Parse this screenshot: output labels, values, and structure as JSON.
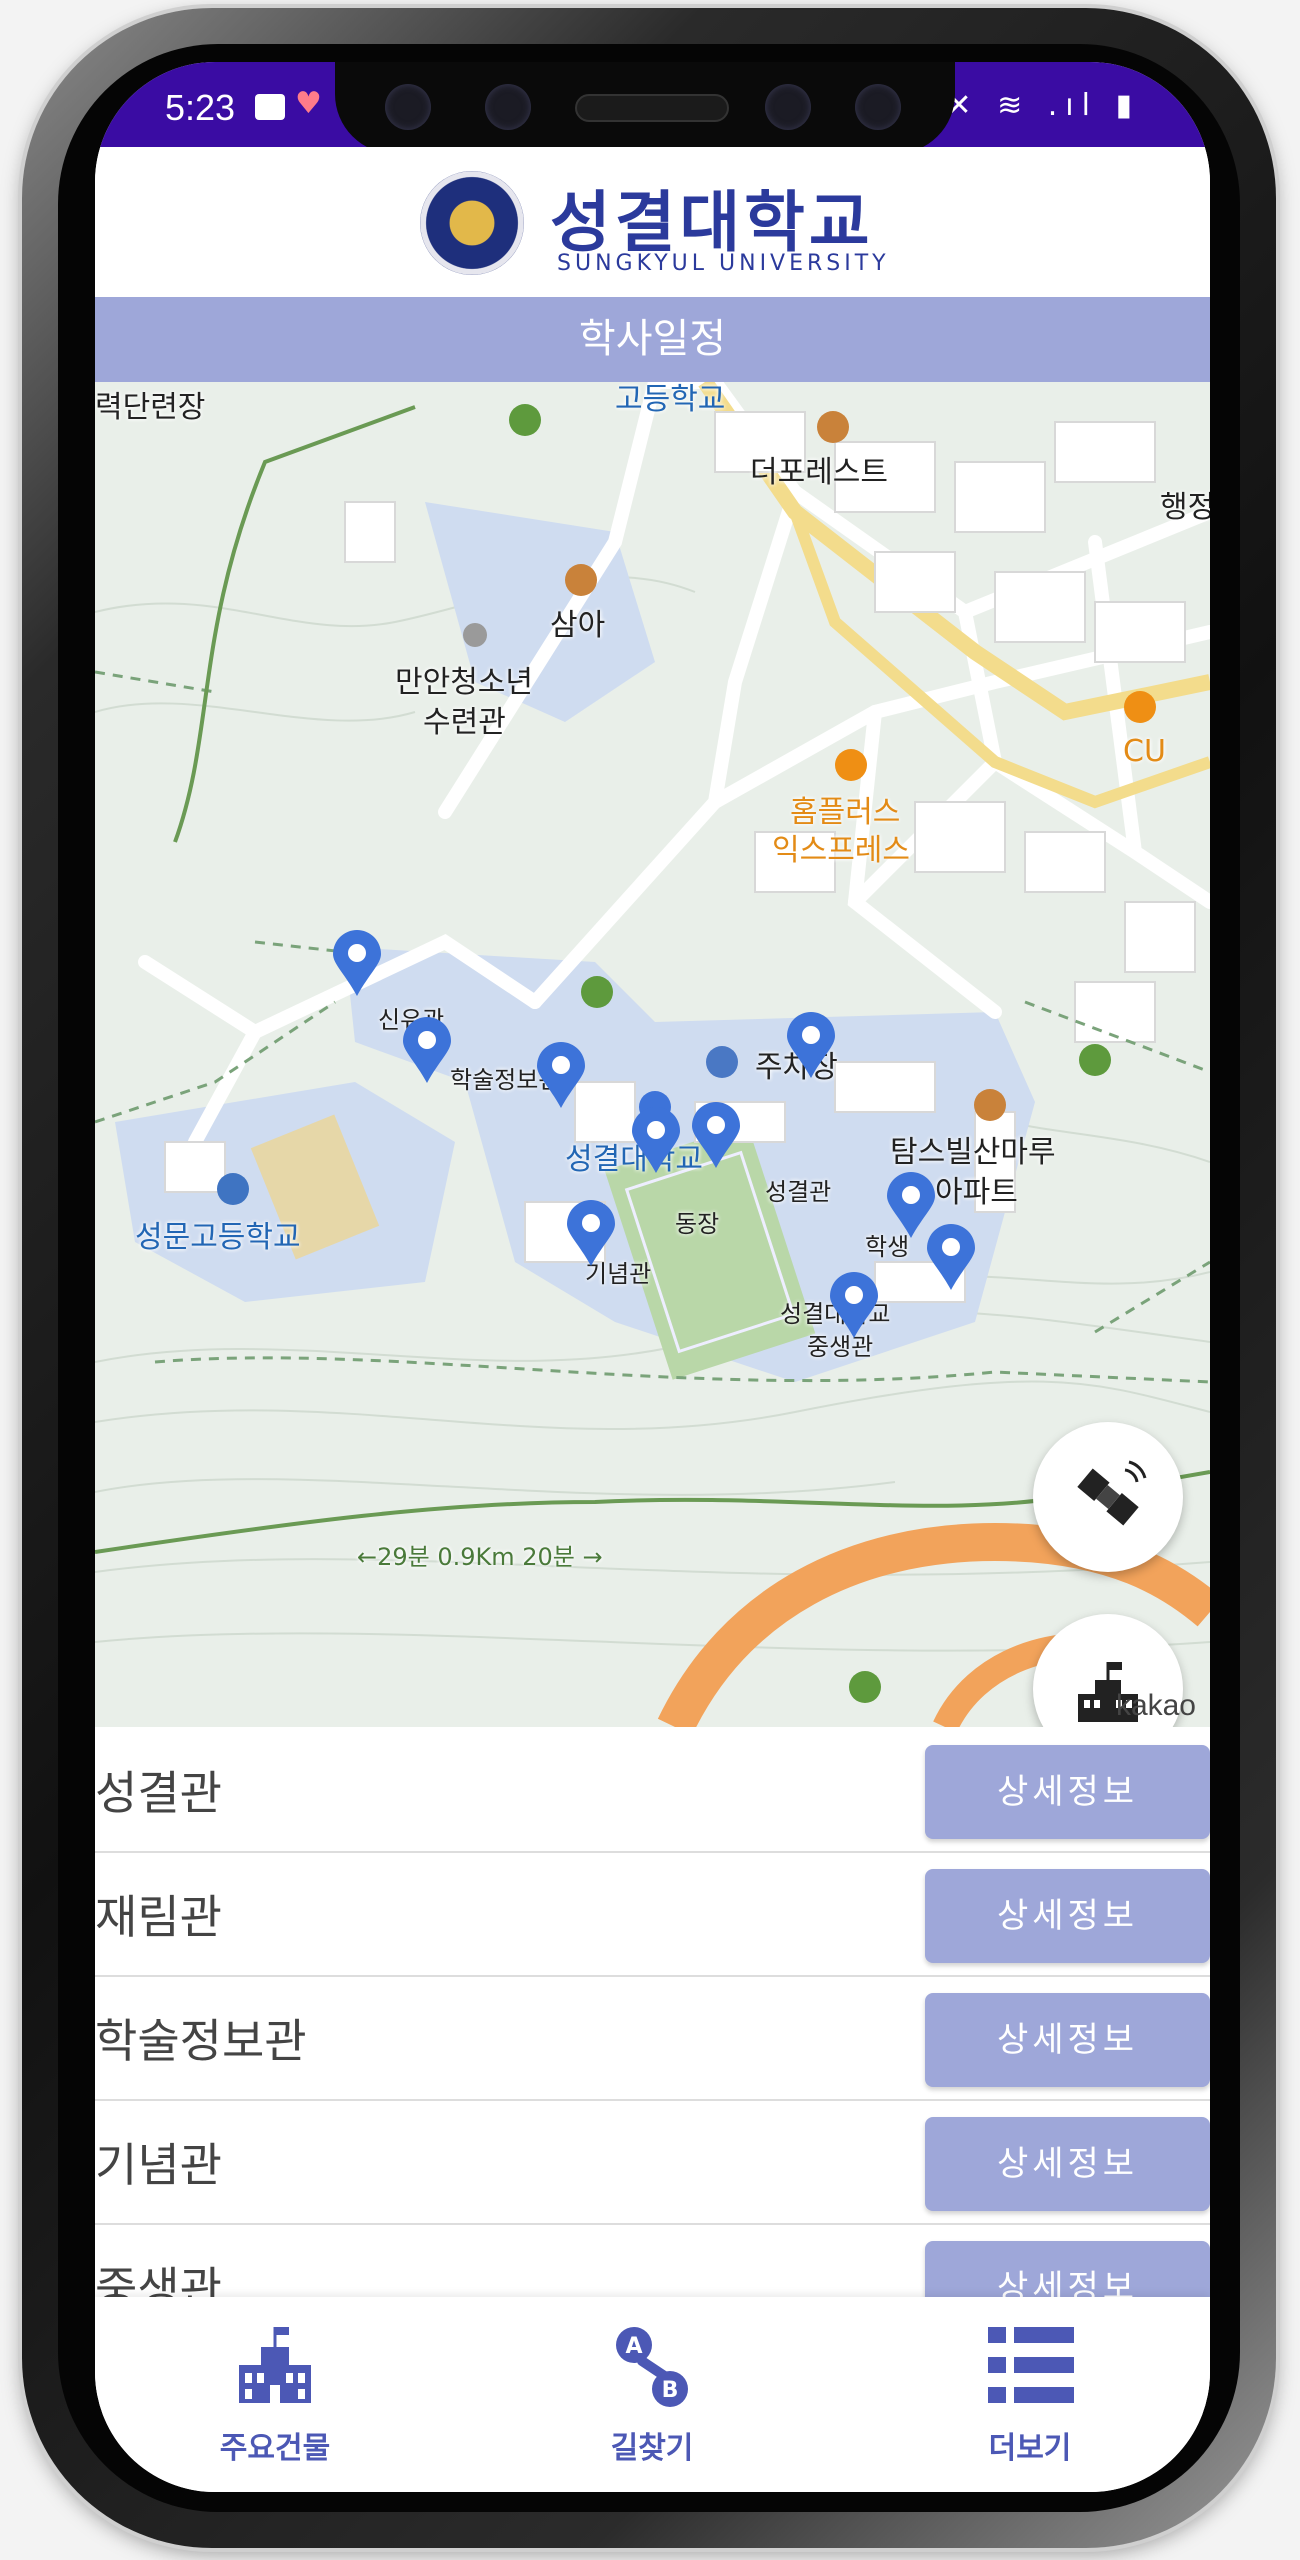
{
  "status_bar": {
    "time": "5:23",
    "right_icons": "✕ ≋ .ıl ▮"
  },
  "header": {
    "logo_ko": "성결대학교",
    "logo_en": "SUNGKYUL UNIVERSITY",
    "subtitle": "학사일정"
  },
  "map": {
    "labels": {
      "l1": "력단련장",
      "l2": "고등학교",
      "l3": "더포레스트",
      "l4": "행정",
      "l5": "삼아",
      "l6": "만안청소년",
      "l7": "수련관",
      "l8": "CU",
      "l9": "홈플러스",
      "l10": "익스프레스",
      "l11": "신유관",
      "l12": "학술정보관",
      "l13": "주차장",
      "l14": "성결대학교",
      "l15": "탐스빌산마루",
      "l16": "아파트",
      "l17": "성결관",
      "l18": "성문고등학교",
      "l19": "동장",
      "l20": "학생",
      "l21": "기념관",
      "l22": "성결대학교",
      "l23": "중생관",
      "l24": "←29분 0.9Km 20분 →"
    },
    "attribution": "kakao",
    "pin_color": "#3d73d9"
  },
  "buildings": [
    {
      "name": "성결관",
      "button": "상세정보"
    },
    {
      "name": "재림관",
      "button": "상세정보"
    },
    {
      "name": "학술정보관",
      "button": "상세정보"
    },
    {
      "name": "기념관",
      "button": "상세정보"
    },
    {
      "name": "중생관",
      "button": "상세정보"
    }
  ],
  "nav": {
    "main_buildings": "주요건물",
    "directions": "길찾기",
    "more": "더보기"
  },
  "colors": {
    "accent": "#9ea7d9",
    "status_bar": "#3a0ca3",
    "brand": "#2b3a9c",
    "nav_label": "#4c58b5"
  }
}
